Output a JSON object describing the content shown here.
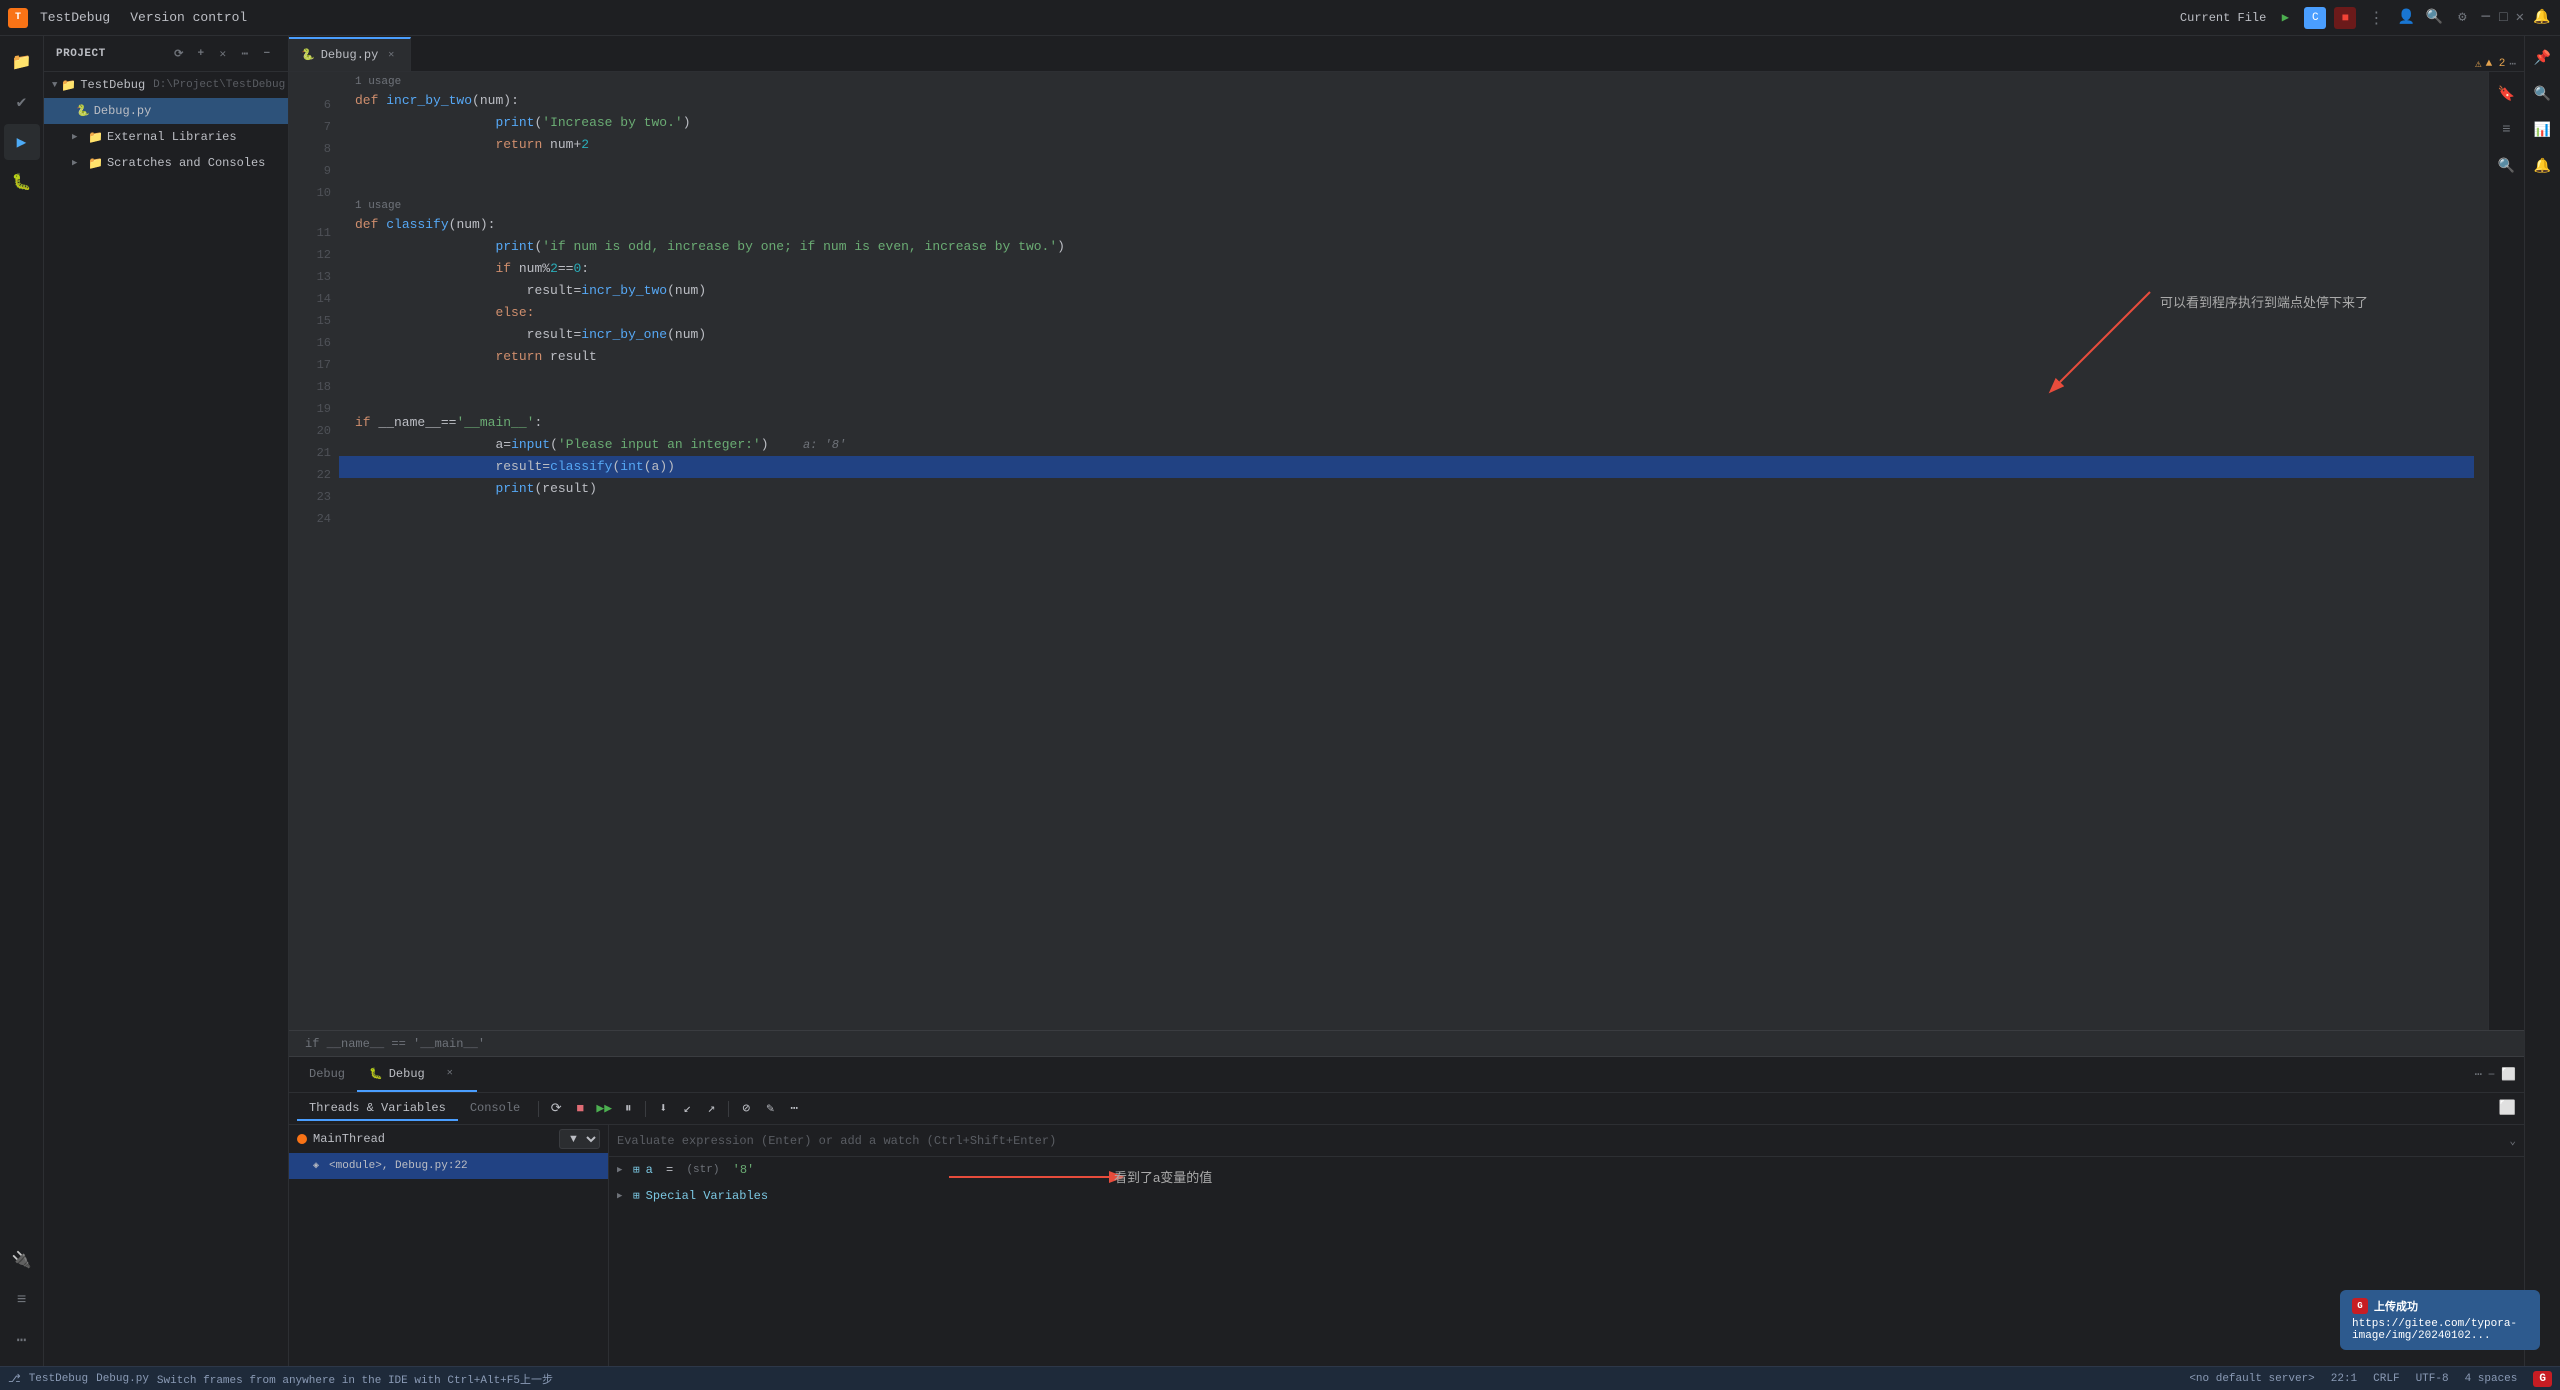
{
  "app": {
    "title": "TestDebug",
    "subtitle": "Version control",
    "logo_letter": "T"
  },
  "top_bar": {
    "project_label": "Project",
    "version_control_label": "Version control",
    "current_file_label": "Current File",
    "run_tooltip": "Run",
    "stop_tooltip": "Stop"
  },
  "sidebar": {
    "header": "Project",
    "root_name": "TestDebug",
    "root_path": "D:\\Project\\TestDebug",
    "items": [
      {
        "label": "TestDebug",
        "type": "folder",
        "expanded": true,
        "depth": 0
      },
      {
        "label": "Debug.py",
        "type": "file_py",
        "expanded": false,
        "depth": 1,
        "selected": true
      },
      {
        "label": "External Libraries",
        "type": "folder",
        "expanded": false,
        "depth": 1
      },
      {
        "label": "Scratches and Consoles",
        "type": "folder",
        "expanded": false,
        "depth": 1
      }
    ]
  },
  "editor": {
    "filename": "Debug.py",
    "tab_active": true,
    "warnings": "▲ 2",
    "lines": [
      {
        "num": 6,
        "content": "def incr_by_two(num):",
        "type": "code"
      },
      {
        "num": 7,
        "content": "    print('Increase by two.')",
        "type": "code"
      },
      {
        "num": 8,
        "content": "    return num + 2",
        "type": "code"
      },
      {
        "num": 9,
        "content": "",
        "type": "empty"
      },
      {
        "num": 10,
        "content": "",
        "type": "empty"
      },
      {
        "num": 11,
        "content": "def classify(num):",
        "type": "code"
      },
      {
        "num": 12,
        "content": "    print('if num is odd, increase by one; if num is even, increase by two.')",
        "type": "code"
      },
      {
        "num": 13,
        "content": "    if num % 2 == 0:",
        "type": "code"
      },
      {
        "num": 14,
        "content": "        result = incr_by_two(num)",
        "type": "code"
      },
      {
        "num": 15,
        "content": "    else:",
        "type": "code"
      },
      {
        "num": 16,
        "content": "        result = incr_by_one(num)",
        "type": "code"
      },
      {
        "num": 17,
        "content": "    return result",
        "type": "code"
      },
      {
        "num": 18,
        "content": "",
        "type": "empty"
      },
      {
        "num": 19,
        "content": "",
        "type": "empty"
      },
      {
        "num": 20,
        "content": "if __name__ == '__main__':",
        "type": "code",
        "has_run_arrow": true
      },
      {
        "num": 21,
        "content": "    a = input('Please input an integer:')   a: '8'",
        "type": "code"
      },
      {
        "num": 22,
        "content": "    result = classify(int(a))",
        "type": "code",
        "highlighted": true,
        "has_breakpoint": true
      },
      {
        "num": 23,
        "content": "    print(result)",
        "type": "code"
      },
      {
        "num": 24,
        "content": "",
        "type": "empty"
      }
    ],
    "usage_hints": [
      {
        "after_line": 5,
        "text": "1 usage"
      },
      {
        "after_line": 10,
        "text": "1 usage"
      }
    ],
    "breadcrumb": "if __name__ == '__main__'",
    "annotation_cn": "可以看到程序执行到端点处停下来了"
  },
  "debug_panel": {
    "tabs": [
      {
        "label": "Debug",
        "active": false,
        "has_icon": true
      },
      {
        "label": "Debug",
        "active": true,
        "has_icon": true,
        "closeable": true
      }
    ],
    "toolbar": {
      "subtabs": [
        {
          "label": "Threads & Variables",
          "active": true
        },
        {
          "label": "Console",
          "active": false
        }
      ],
      "buttons": [
        {
          "icon": "⟳",
          "tooltip": "Rerun"
        },
        {
          "icon": "■",
          "tooltip": "Stop"
        },
        {
          "icon": "▶",
          "tooltip": "Resume"
        },
        {
          "icon": "⏸",
          "tooltip": "Pause"
        },
        {
          "icon": "⬇",
          "tooltip": "Step Over"
        },
        {
          "icon": "↓",
          "tooltip": "Step Into"
        },
        {
          "icon": "↑",
          "tooltip": "Step Out"
        },
        {
          "icon": "⊘",
          "tooltip": "Run to Cursor"
        },
        {
          "icon": "✎",
          "tooltip": "Edit"
        },
        {
          "icon": "⋯",
          "tooltip": "More"
        }
      ]
    },
    "threads": {
      "main_thread": "MainThread",
      "thread_state": "RUNNING",
      "stack_frames": [
        {
          "label": "<module>, Debug.py:22",
          "selected": true
        }
      ]
    },
    "variables": {
      "evaluate_placeholder": "Evaluate expression (Enter) or add a watch (Ctrl+Shift+Enter)",
      "items": [
        {
          "name": "a",
          "type": "(str)",
          "value": "'8'",
          "expanded": false,
          "depth": 0
        },
        {
          "name": "Special Variables",
          "type": "",
          "value": "",
          "expanded": false,
          "depth": 0,
          "has_chevron": true
        }
      ]
    },
    "annotation_cn": "看到了a变量的值"
  },
  "status_bar": {
    "server": "<no default server>",
    "position": "22:1",
    "line_ending": "CRLF",
    "encoding": "UTF-8",
    "indent": "4 spaces",
    "bottom_text": "Switch frames from anywhere in the IDE with Ctrl+Alt+F5上一步"
  },
  "gitee_notification": {
    "title": "上传成功",
    "url": "https://gitee.com/typora-image/img/20240102..."
  },
  "icons": {
    "folder": "📁",
    "file_py": "🐍",
    "search": "🔍",
    "settings": "⚙",
    "run": "▶",
    "debug_green": "🐛",
    "stop_red": "⏹",
    "person": "👤",
    "bell": "🔔",
    "plug": "🔌",
    "git": "⎇",
    "structure": "≡",
    "bookmark": "🔖",
    "inspect": "🔍",
    "database": "🗄",
    "terminal": "⌨",
    "python": "🐍"
  }
}
